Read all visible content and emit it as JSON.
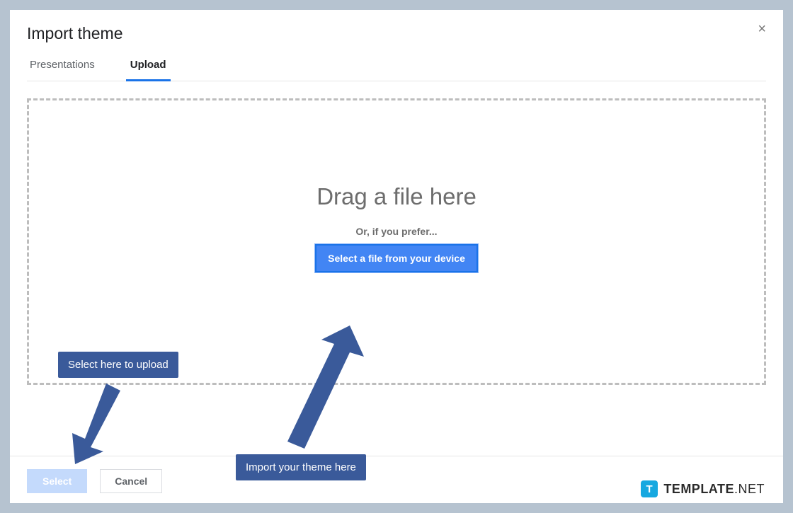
{
  "dialog": {
    "title": "Import theme",
    "close": "×"
  },
  "tabs": {
    "presentations": "Presentations",
    "upload": "Upload"
  },
  "dropzone": {
    "main": "Drag a file here",
    "sub": "Or, if you prefer...",
    "button": "Select a file from your device"
  },
  "footer": {
    "select": "Select",
    "cancel": "Cancel"
  },
  "annotations": {
    "select_upload": "Select here to upload",
    "import_theme": "Import your theme here"
  },
  "brand": {
    "icon_letter": "T",
    "name": "TEMPLATE",
    "suffix": ".NET"
  }
}
